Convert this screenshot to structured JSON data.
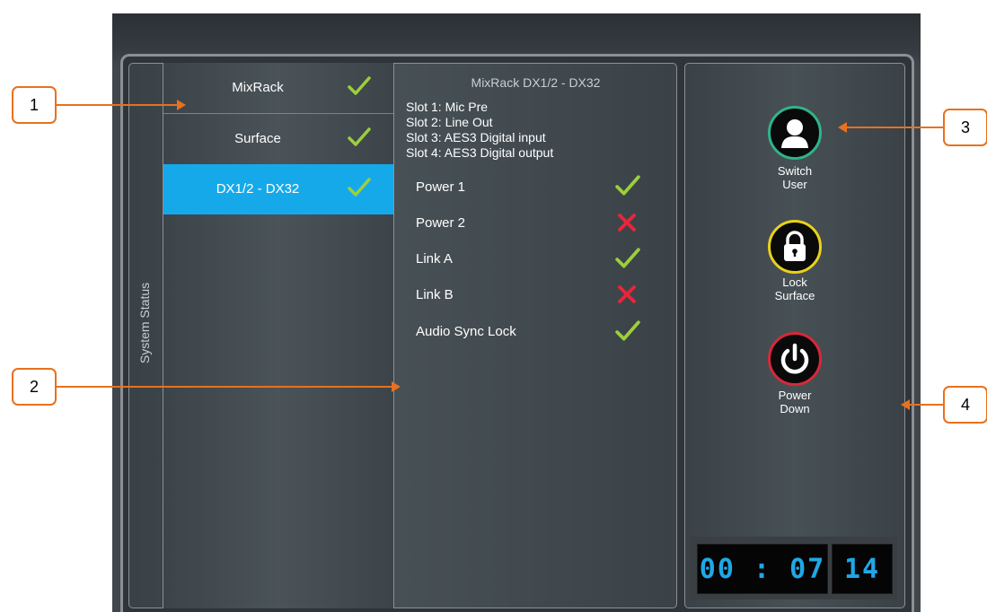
{
  "sidebar": {
    "title": "System Status"
  },
  "devices": [
    {
      "label": "MixRack",
      "status": "ok"
    },
    {
      "label": "Surface",
      "status": "ok"
    },
    {
      "label": "DX1/2 - DX32",
      "status": "ok",
      "selected": true
    }
  ],
  "detail": {
    "title": "MixRack DX1/2 - DX32",
    "slots": [
      "Slot 1: Mic Pre",
      "Slot 2: Line Out",
      "Slot 3: AES3 Digital input",
      "Slot 4: AES3 Digital output"
    ],
    "statuses": [
      {
        "label": "Power 1",
        "status": "ok"
      },
      {
        "label": "Power 2",
        "status": "fail"
      },
      {
        "label": "Link A",
        "status": "ok"
      },
      {
        "label": "Link B",
        "status": "fail"
      },
      {
        "label": "Audio Sync Lock",
        "status": "ok"
      }
    ]
  },
  "actions": {
    "switch_user": {
      "line1": "Switch",
      "line2": "User",
      "icon": "user-icon",
      "ring_color": "#2fb48a"
    },
    "lock_surface": {
      "line1": "Lock",
      "line2": "Surface",
      "icon": "lock-icon",
      "ring_color": "#e9d21a"
    },
    "power_down": {
      "line1": "Power",
      "line2": "Down",
      "icon": "power-icon",
      "ring_color": "#d8283a"
    }
  },
  "clock": {
    "time": "00 : 07",
    "frames": "14",
    "color": "#1fa8e8"
  },
  "callouts": [
    "1",
    "2",
    "3",
    "4"
  ],
  "colors": {
    "ok": "#9ccf3c",
    "fail": "#e8263a",
    "selected": "#16a9ea",
    "callout": "#e8711e"
  }
}
